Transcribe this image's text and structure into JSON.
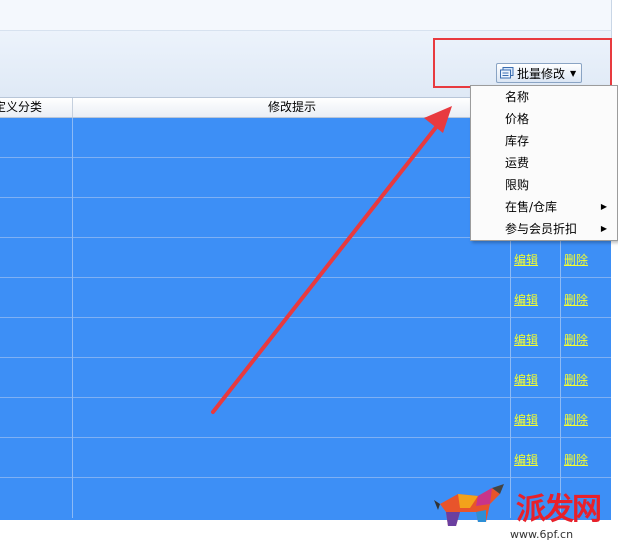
{
  "toolbar": {
    "batch_edit_label": "批量修改"
  },
  "grid": {
    "headers": [
      "定义分类",
      "修改提示"
    ],
    "row_actions": [
      {
        "edit": "",
        "delete": ""
      },
      {
        "edit": "",
        "delete": ""
      },
      {
        "edit": "",
        "delete": ""
      },
      {
        "edit": "编辑",
        "delete": "删除"
      },
      {
        "edit": "编辑",
        "delete": "删除"
      },
      {
        "edit": "编辑",
        "delete": "删除"
      },
      {
        "edit": "编辑",
        "delete": "删除"
      },
      {
        "edit": "编辑",
        "delete": "删除"
      },
      {
        "edit": "编辑",
        "delete": "删除"
      },
      {
        "edit": "",
        "delete": ""
      }
    ]
  },
  "dropdown": {
    "items": [
      {
        "label": "名称",
        "has_submenu": false
      },
      {
        "label": "价格",
        "has_submenu": false
      },
      {
        "label": "库存",
        "has_submenu": false
      },
      {
        "label": "运费",
        "has_submenu": false
      },
      {
        "label": "限购",
        "has_submenu": false
      },
      {
        "label": "在售/仓库",
        "has_submenu": true
      },
      {
        "label": "参与会员折扣",
        "has_submenu": true
      }
    ]
  },
  "watermark": {
    "brand": "派发网",
    "site": "www.6pf.cn"
  },
  "colors": {
    "grid_bg": "#3d8ff6",
    "link": "#f4ff2e",
    "annotation": "#e83a3f"
  }
}
